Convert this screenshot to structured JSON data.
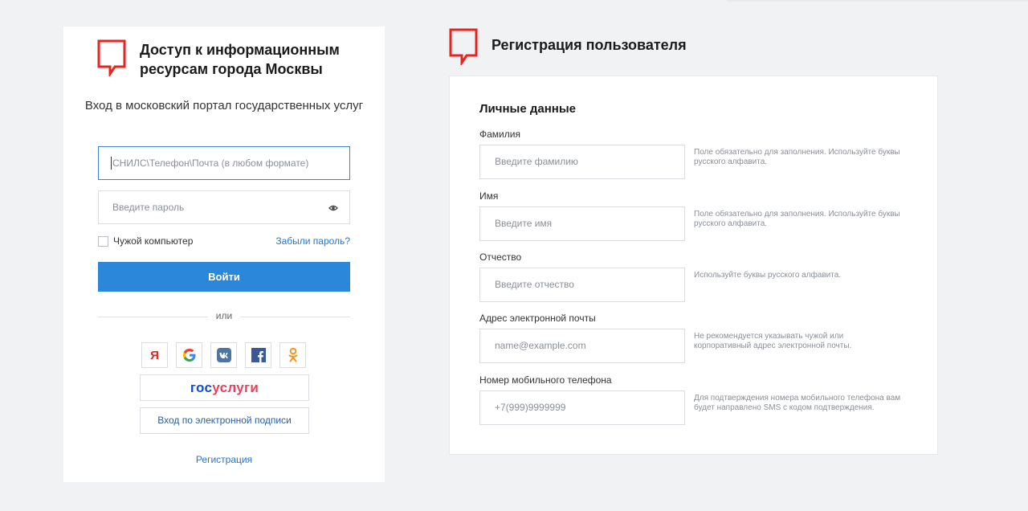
{
  "login": {
    "title": "Доступ к информационным ресурсам города Москвы",
    "subtitle": "Вход в московский портал государственных услуг",
    "login_placeholder": "СНИЛС\\Телефон\\Почта (в любом формате)",
    "password_placeholder": "Введите пароль",
    "remember_label": "Чужой компьютер",
    "forgot_link": "Забыли пароль?",
    "submit_label": "Войти",
    "divider_label": "или",
    "socials": [
      {
        "name": "yandex",
        "glyph": "Я"
      },
      {
        "name": "google"
      },
      {
        "name": "vk"
      },
      {
        "name": "facebook"
      },
      {
        "name": "odnoklassniki"
      }
    ],
    "gosuslugi_gos": "гос",
    "gosuslugi_uslugi": "услуги",
    "esign_button": "Вход по электронной подписи",
    "register_link": "Регистрация"
  },
  "registration": {
    "title": "Регистрация пользователя",
    "section_title": "Личные данные",
    "fields": [
      {
        "label": "Фамилия",
        "placeholder": "Введите фамилию",
        "hint": "Поле обязательно для заполнения. Используйте буквы русского алфавита."
      },
      {
        "label": "Имя",
        "placeholder": "Введите имя",
        "hint": "Поле обязательно для заполнения. Используйте буквы русского алфавита."
      },
      {
        "label": "Отчество",
        "placeholder": "Введите отчество",
        "hint": "Используйте буквы русского алфавита."
      },
      {
        "label": "Адрес электронной почты",
        "placeholder": "name@example.com",
        "hint": "Не рекомендуется указывать чужой или корпоративный адрес электронной почты."
      },
      {
        "label": "Номер мобильного телефона",
        "placeholder": "+7(999)9999999",
        "hint": "Для подтверждения номера мобильного телефона вам будет направлено SMS с кодом подтверждения."
      }
    ]
  },
  "colors": {
    "brand_red": "#e52620",
    "primary_blue": "#2b87da",
    "link_blue": "#2b73c7",
    "background": "#f1f2f4"
  }
}
